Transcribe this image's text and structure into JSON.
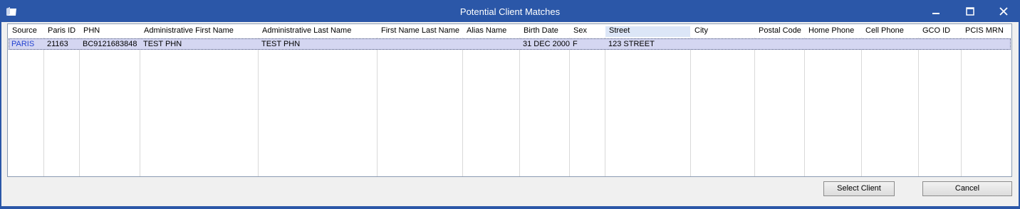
{
  "window": {
    "title": "Potential Client Matches",
    "icons": {
      "app": "folder-icon",
      "minimize": "minimize-icon",
      "maximize": "maximize-icon",
      "close": "close-icon"
    }
  },
  "grid": {
    "columns": [
      "Source",
      "Paris ID",
      "PHN",
      "Administrative First Name",
      "Administrative Last Name",
      "First Name Last Name",
      "Alias Name",
      "Birth Date",
      "Sex",
      "Street",
      "City",
      "Postal Code",
      "Home Phone",
      "Cell Phone",
      "GCO ID",
      "PCIS MRN"
    ],
    "sorted_column": "Street",
    "rows": [
      {
        "source": "PARIS",
        "paris_id": "21163",
        "phn": "BC9121683848",
        "admin_first_name": "TEST PHN",
        "admin_last_name": "TEST PHN",
        "first_last_name": "",
        "alias_name": "",
        "birth_date": "31 DEC 2000",
        "sex": "F",
        "street": "123 STREET",
        "city": "",
        "postal_code": "",
        "home_phone": "",
        "cell_phone": "",
        "gco_id": "",
        "pcis_mrn": ""
      }
    ]
  },
  "buttons": {
    "select_label": "Select Client",
    "cancel_label": "Cancel"
  },
  "colors": {
    "titlebar": "#2b57a8",
    "selected_row": "#d4d6f1",
    "link_text": "#2443d0"
  }
}
